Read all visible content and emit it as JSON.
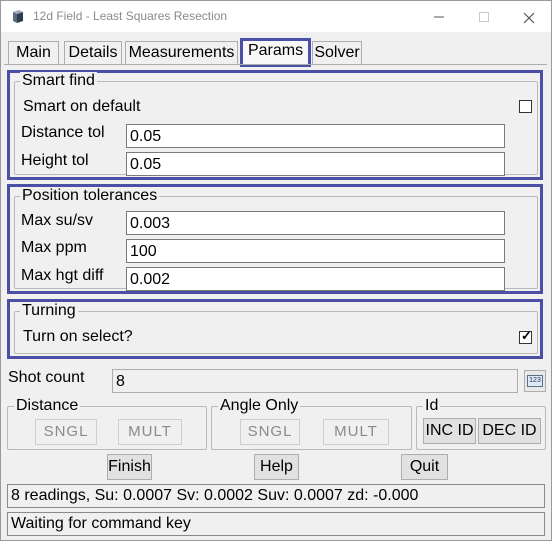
{
  "window": {
    "title": "12d Field - Least Squares Resection"
  },
  "tabs": [
    "Main",
    "Details",
    "Measurements",
    "Params",
    "Solver"
  ],
  "active_tab": "Params",
  "smart_find": {
    "legend": "Smart find",
    "smart_on_default_label": "Smart on default",
    "smart_on_default_checked": false,
    "distance_tol_label": "Distance tol",
    "distance_tol_value": "0.05",
    "height_tol_label": "Height tol",
    "height_tol_value": "0.05"
  },
  "position_tolerances": {
    "legend": "Position tolerances",
    "max_su_sv_label": "Max su/sv",
    "max_su_sv_value": "0.003",
    "max_ppm_label": "Max ppm",
    "max_ppm_value": "100",
    "max_hgt_diff_label": "Max hgt diff",
    "max_hgt_diff_value": "0.002"
  },
  "turning": {
    "legend": "Turning",
    "turn_on_select_label": "Turn on select?",
    "turn_on_select_checked": true
  },
  "shot_count": {
    "label": "Shot count",
    "value": "8",
    "calc_icon_text": "123"
  },
  "distance": {
    "legend": "Distance",
    "sngl": "SNGL",
    "mult": "MULT"
  },
  "angle_only": {
    "legend": "Angle Only",
    "sngl": "SNGL",
    "mult": "MULT"
  },
  "id_group": {
    "legend": "Id",
    "inc": "INC ID",
    "dec": "DEC ID"
  },
  "actions": {
    "finish": "Finish",
    "help": "Help",
    "quit": "Quit"
  },
  "status": {
    "line1": "8 readings, Su: 0.0007 Sv: 0.0002 Suv: 0.0007 zd: -0.000",
    "line2": "Waiting for command key"
  },
  "colors": {
    "highlight": "#4b4fa6",
    "background": "#f0f0f0"
  }
}
